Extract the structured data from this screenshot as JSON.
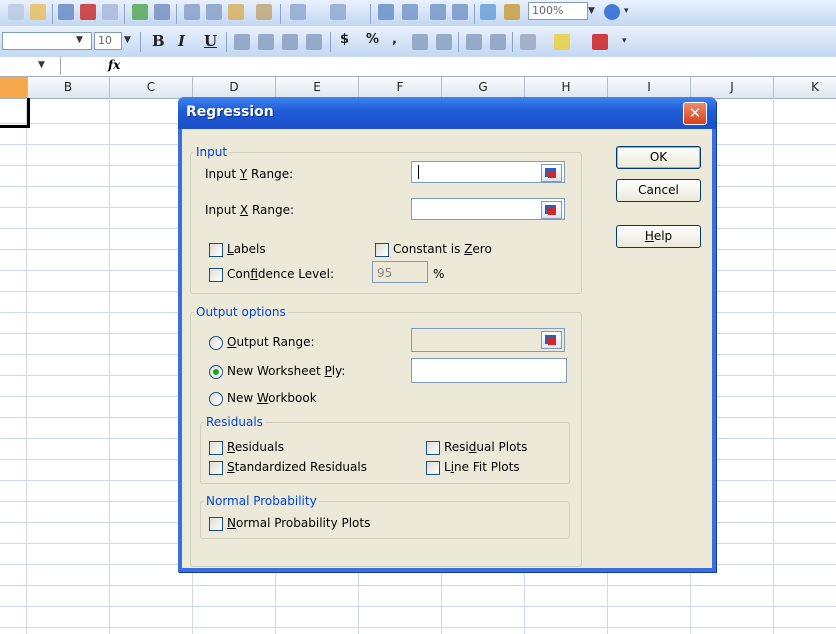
{
  "toolbar": {
    "zoom_value": "100%",
    "font_size": "10",
    "bold_label": "B",
    "italic_label": "I",
    "underline_label": "U",
    "currency_label": "$",
    "percent_label": "%",
    "comma_label": ","
  },
  "formula_bar": {
    "fx_label": "fx"
  },
  "columns": [
    "B",
    "C",
    "D",
    "E",
    "F",
    "G",
    "H",
    "I",
    "J",
    "K"
  ],
  "dialog": {
    "title": "Regression",
    "close_label": "✕",
    "input": {
      "legend": "Input",
      "y_range_pre": "Input ",
      "y_range_u": "Y",
      "y_range_post": " Range:",
      "y_range_value": "",
      "x_range_pre": "Input ",
      "x_range_u": "X",
      "x_range_post": " Range:",
      "x_range_value": "",
      "labels_u": "L",
      "labels_post": "abels",
      "constant_pre": "Constant is ",
      "constant_u": "Z",
      "constant_post": "ero",
      "confidence_pre": "Con",
      "confidence_u": "f",
      "confidence_post": "idence Level:",
      "confidence_value": "95",
      "percent_sign": "%"
    },
    "output": {
      "legend": "Output options",
      "output_range_u": "O",
      "output_range_post": "utput Range:",
      "new_ply_pre": "New Worksheet ",
      "new_ply_u": "P",
      "new_ply_post": "ly:",
      "new_workbook_pre": "New ",
      "new_workbook_u": "W",
      "new_workbook_post": "orkbook"
    },
    "residuals": {
      "legend": "Residuals",
      "residuals_u": "R",
      "residuals_post": "esiduals",
      "standardized_u": "S",
      "standardized_post": "tandardized Residuals",
      "residual_plots_pre": "Resi",
      "residual_plots_u": "d",
      "residual_plots_post": "ual Plots",
      "line_fit_pre": "L",
      "line_fit_u": "i",
      "line_fit_post": "ne Fit Plots"
    },
    "normal": {
      "legend": "Normal Probability",
      "plots_u": "N",
      "plots_post": "ormal Probability Plots"
    },
    "buttons": {
      "ok": "OK",
      "cancel": "Cancel",
      "help_u": "H",
      "help_post": "elp"
    }
  }
}
